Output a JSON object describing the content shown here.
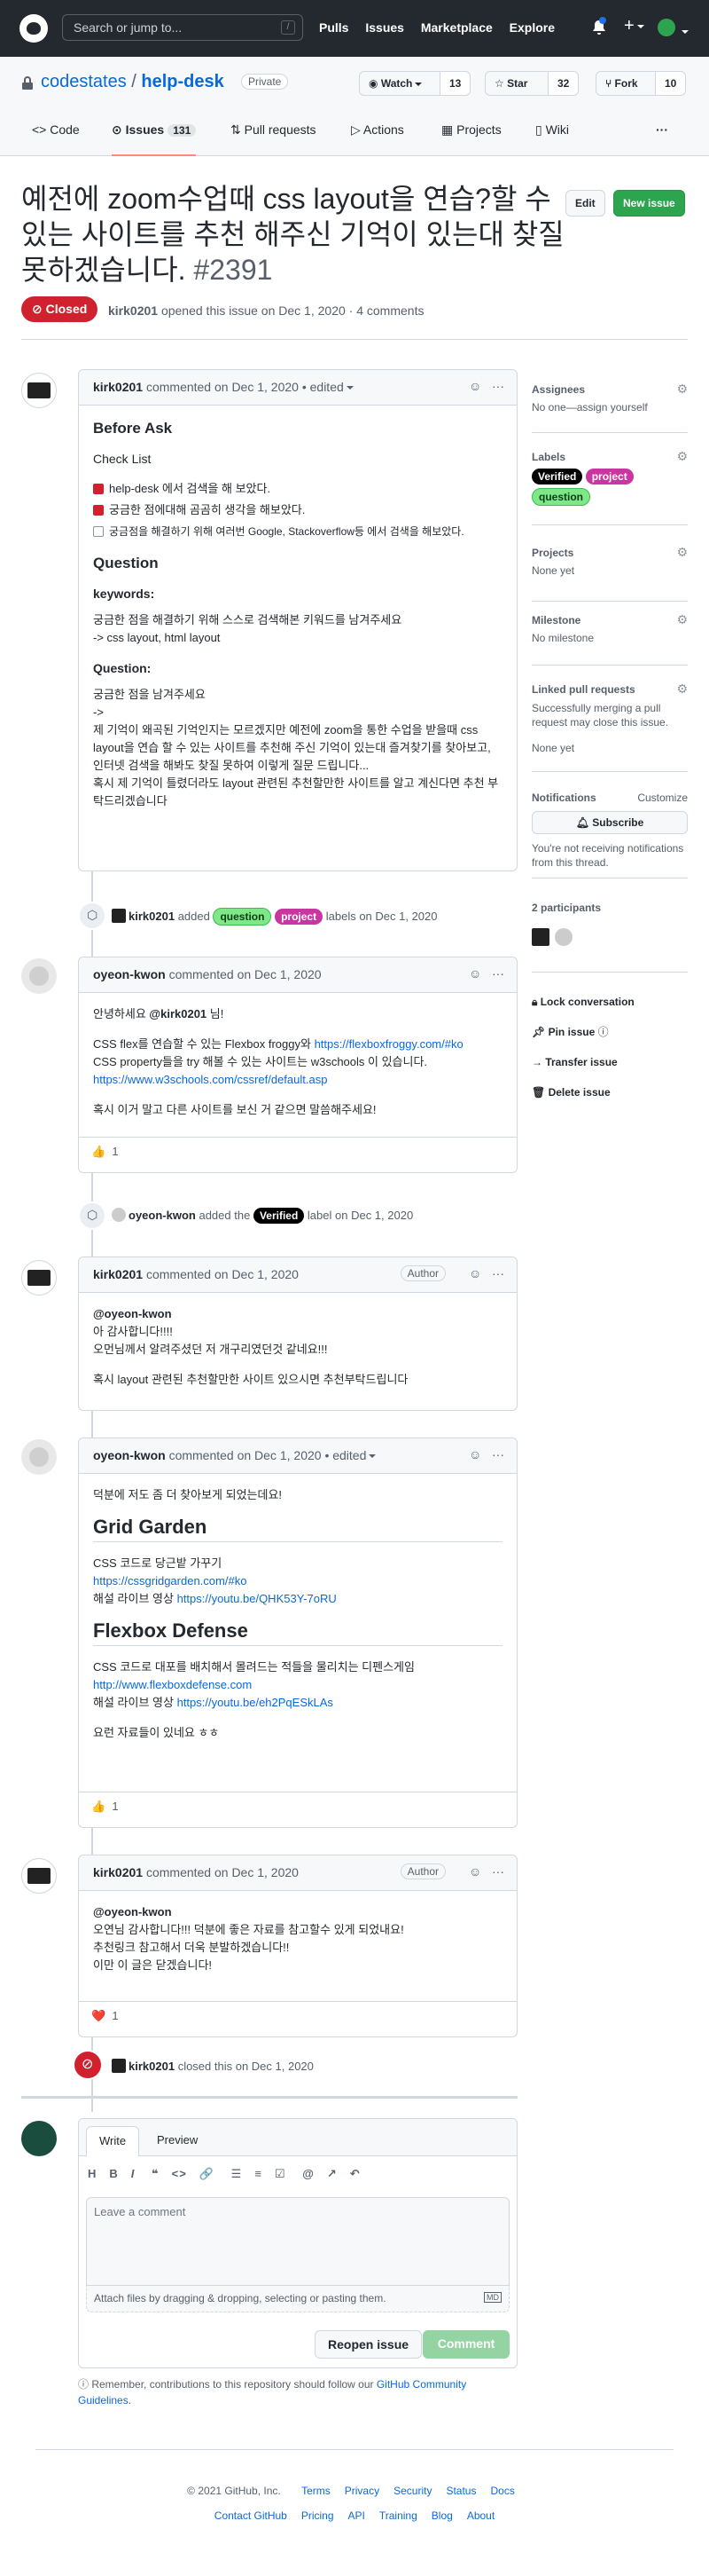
{
  "header": {
    "search_placeholder": "Search or jump to...",
    "search_shortcut": "/",
    "nav": [
      "Pulls",
      "Issues",
      "Marketplace",
      "Explore"
    ]
  },
  "repo": {
    "owner": "codestates",
    "sep": " / ",
    "name": "help-desk",
    "visibility": "Private",
    "watch_label": "Watch",
    "watch_count": "13",
    "star_label": "Star",
    "star_count": "32",
    "fork_label": "Fork",
    "fork_count": "10",
    "tabs": [
      {
        "label": "Code"
      },
      {
        "label": "Issues",
        "count": "131"
      },
      {
        "label": "Pull requests"
      },
      {
        "label": "Actions"
      },
      {
        "label": "Projects"
      },
      {
        "label": "Wiki"
      }
    ],
    "more": "···"
  },
  "issue": {
    "title": "예전에 zoom수업때 css layout을 연습?할 수 있는 사이트를 추천 해주신 기억이 있는대 찾질 못하겠습니다.",
    "number": "#2391",
    "state": "Closed",
    "author": "kirk0201",
    "meta_rest": "opened this issue on Dec 1, 2020 · 4 comments",
    "edit_label": "Edit",
    "new_issue_label": "New issue"
  },
  "comment1": {
    "author": "kirk0201",
    "meta": "commented on Dec 1, 2020 • edited",
    "h_before": "Before Ask",
    "h_checklist": "Check List",
    "checks": [
      "help-desk 에서 검색을 해 보았다.",
      "궁금한 점에대해 곰곰히 생각을 해보았다.",
      "궁금점을 해결하기 위해 여러번 Google, Stackoverflow등 에서 검색을 해보았다."
    ],
    "h_question": "Question",
    "h_keywords": "keywords:",
    "kw1": "궁금한 점을 해결하기 위해 스스로 검색해본 키워드를 남겨주세요",
    "kw2": "-> css layout, html layout",
    "h_q2": "Question:",
    "q1": "궁금한 점을 남겨주세요",
    "q2": "->",
    "q3": "제 기억이 왜곡된 기억인지는 모르겠지만 예전에 zoom을 통한 수업을 받을때 css layout을 연습 할 수 있는 사이트를 추천해 주신 기억이 있는대 즐겨찾기를 찾아보고, 인터넷 검색을 해봐도 찾질 못하여 이렇게 질문 드립니다...",
    "q4": "혹시 제 기억이 틀렸더라도 layout 관련된 추천할만한 사이트를 알고 계신다면 추천 부탁드리겠습니다"
  },
  "event1": {
    "actor": "kirk0201",
    "pre": "added",
    "labels": [
      "question",
      "project"
    ],
    "post": "labels on Dec 1, 2020"
  },
  "comment2": {
    "author": "oyeon-kwon",
    "meta": "commented on Dec 1, 2020",
    "l1a": "안녕하세요 ",
    "l1b": "@kirk0201",
    "l1c": " 님!",
    "l2a": "CSS flex를 연습할 수 있는 Flexbox froggy와 ",
    "l2b": "https://flexboxfroggy.com/#ko",
    "l3": "CSS property들을 try 해볼 수 있는 사이트는 w3schools 이 있습니다.",
    "l4": "https://www.w3schools.com/cssref/default.asp",
    "l5": "혹시 이거 말고 다른 사이트를 보신 거 같으면 말씀해주세요!",
    "reaction": "👍",
    "reaction_count": "1"
  },
  "event2": {
    "actor": "oyeon-kwon",
    "pre": "added the",
    "label": "Verified",
    "post": "label on Dec 1, 2020"
  },
  "comment3": {
    "author": "kirk0201",
    "meta": "commented on Dec 1, 2020",
    "badge": "Author",
    "l1": "@oyeon-kwon",
    "l2": "아 감사합니다!!!!",
    "l3": "오먼님께서 알려주셨던 저 개구리였던것 같네요!!!",
    "l4": "혹시 layout 관련된 추천할만한 사이트 있으시면 추천부탁드립니다"
  },
  "comment4": {
    "author": "oyeon-kwon",
    "meta": "commented on Dec 1, 2020 • edited",
    "intro": "덕분에 저도 좀 더 찾아보게 되었는데요!",
    "h1": "Grid Garden",
    "g1": "CSS 코드로 당근밭 가꾸기",
    "g2": "https://cssgridgarden.com/#ko",
    "g3a": "해설 라이브 영상 ",
    "g3b": "https://youtu.be/QHK53Y-7oRU",
    "h2": "Flexbox Defense",
    "f1": "CSS 코드로 대포를 배치해서 몰려드는 적들을 물리치는 디펜스게임",
    "f2": "http://www.flexboxdefense.com",
    "f3a": "해설 라이브 영상 ",
    "f3b": "https://youtu.be/eh2PqESkLAs",
    "outro": "요런 자료들이 있네요 ㅎㅎ",
    "reaction": "👍",
    "reaction_count": "1"
  },
  "comment5": {
    "author": "kirk0201",
    "meta": "commented on Dec 1, 2020",
    "badge": "Author",
    "l1": "@oyeon-kwon",
    "l2": "오연님 감사합니다!!! 덕분에 좋은 자료를 참고할수 있게 되었내요!",
    "l3": "추천링크 참고해서 더욱 분발하겠습니다!!",
    "l4": "이만 이 글은 닫겠습니다!",
    "reaction": "❤️",
    "reaction_count": "1"
  },
  "event3": {
    "actor": "kirk0201",
    "text": "closed this on Dec 1, 2020"
  },
  "editor": {
    "tab_write": "Write",
    "tab_preview": "Preview",
    "toolbar": [
      "H",
      "B",
      "I",
      "❝",
      "<>",
      "🔗",
      "☰",
      "≡",
      "☑",
      "@",
      "↗",
      "↶"
    ],
    "placeholder": "Leave a comment",
    "attach": "Attach files by dragging & dropping, selecting or pasting them.",
    "md_icon": "MD",
    "reopen": "Reopen issue",
    "comment": "Comment",
    "note_a": "Remember, contributions to this repository should follow our ",
    "note_b": "GitHub Community Guidelines",
    "note_c": "."
  },
  "sidebar": {
    "assignees_h": "Assignees",
    "assignees_v": "No one—assign yourself",
    "labels_h": "Labels",
    "labels": [
      "Verified",
      "project",
      "question"
    ],
    "projects_h": "Projects",
    "projects_v": "None yet",
    "milestone_h": "Milestone",
    "milestone_v": "No milestone",
    "linked_h": "Linked pull requests",
    "linked_desc": "Successfully merging a pull request may close this issue.",
    "linked_v": "None yet",
    "notif_h": "Notifications",
    "notif_customize": "Customize",
    "subscribe": "Subscribe",
    "notif_desc": "You're not receiving notifications from this thread.",
    "participants_h": "2 participants",
    "lock": "Lock conversation",
    "pin": "Pin issue",
    "transfer": "Transfer issue",
    "delete": "Delete issue"
  },
  "footer": {
    "copyright": "© 2021 GitHub, Inc.",
    "row1": [
      "Terms",
      "Privacy",
      "Security",
      "Status",
      "Docs"
    ],
    "row2": [
      "Contact GitHub",
      "Pricing",
      "API",
      "Training",
      "Blog",
      "About"
    ]
  },
  "colors": {
    "closed": "#cf222e",
    "link": "#0969da",
    "comment_btn": "#94d3a2"
  }
}
